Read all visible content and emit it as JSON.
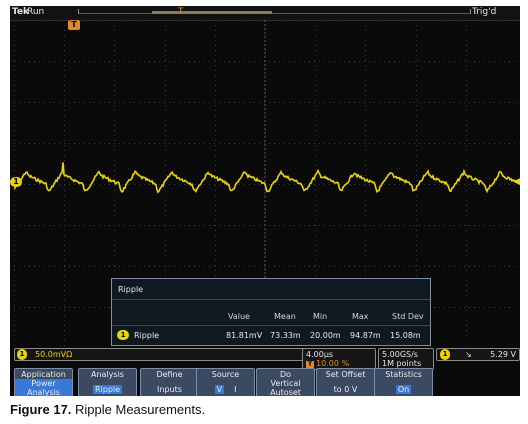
{
  "header": {
    "brand": "Tek",
    "run_state": "Run",
    "trigger_state": "Trig'd",
    "trigger_marker": "T"
  },
  "channel_marker": "1",
  "ripple_panel": {
    "title": "Ripple",
    "columns": [
      "Value",
      "Mean",
      "Min",
      "Max",
      "Std Dev"
    ],
    "row": {
      "channel": "1",
      "name": "Ripple",
      "values": [
        "81.81mV",
        "73.33m",
        "20.00m",
        "94.87m",
        "15.08m"
      ]
    }
  },
  "status": {
    "ch1_badge": "1",
    "ch1_scale": "50.0mVΩ",
    "timebase": "4.00µs",
    "trigger_position": "10.00 %",
    "trigger_position_badge": "T",
    "sample_rate": "5.00GS/s",
    "record_length": "1M points",
    "trigger_source": "1",
    "trigger_slope": "↘",
    "trigger_level": "5.29 V"
  },
  "menu": [
    {
      "line1": "Application",
      "line2": "Power Analysis"
    },
    {
      "line1": "Analysis",
      "line2": "Ripple"
    },
    {
      "line1": "Define",
      "line2": "Inputs"
    },
    {
      "line1": "Source",
      "v": "V",
      "i": "I"
    },
    {
      "line1": "Do",
      "line2": "Vertical",
      "line3": "Autoset"
    },
    {
      "line1": "Set Offset",
      "line2": "to 0 V"
    },
    {
      "line1": "Statistics",
      "line2": "On"
    }
  ],
  "caption": {
    "label": "Figure 17.",
    "text": " Ripple Measurements."
  },
  "colors": {
    "ch1": "#e8d40c",
    "trigger": "#e08a2a",
    "menu": "#3b4a60",
    "highlight": "#3a78d8"
  }
}
